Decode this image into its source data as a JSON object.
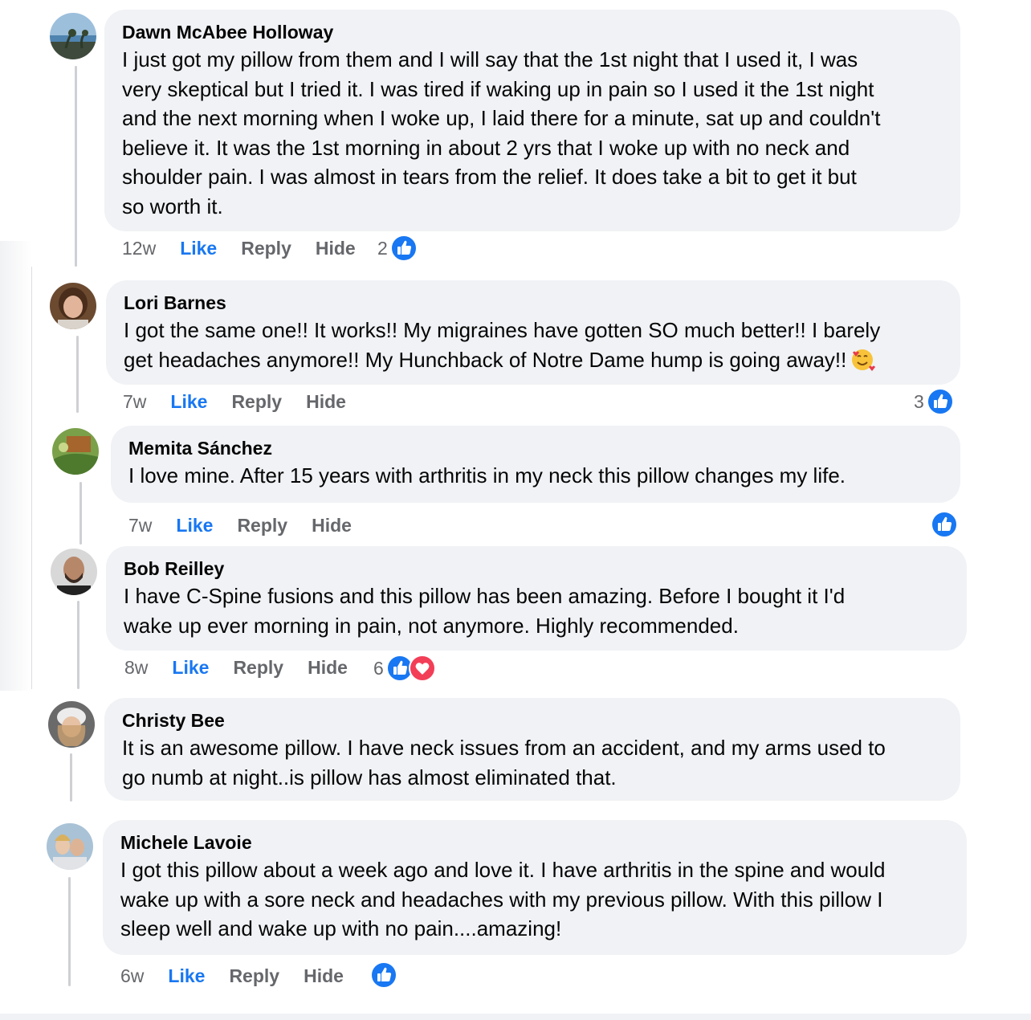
{
  "colors": {
    "bubble": "#f0f2f5",
    "like_blue": "#1877f2",
    "love_red": "#f33e58",
    "meta_gray": "#65676b",
    "thread_line": "#ced0d4"
  },
  "comments": [
    {
      "author": "Dawn McAbee Holloway",
      "text": "I just got my pillow from them and I will say that the 1st night that I used it, I was\nvery skeptical but I tried it. I was tired if waking up in pain so I used it the 1st night\nand the next morning when I woke up, I laid there for a minute, sat up and couldn't\nbelieve it. It was the 1st morning in about 2 yrs that I woke up with no neck and\nshoulder pain. I was almost in tears from the relief. It does take a bit to get it but\nso worth it.",
      "time": "12w",
      "like": "Like",
      "reply": "Reply",
      "hide": "Hide",
      "reaction_count": "2",
      "reactions": [
        "like-icon"
      ]
    },
    {
      "author": "Lori Barnes",
      "text": "I got the same one!! It works!! My migraines have gotten SO much better!! I barely\nget headaches anymore!! My Hunchback of Notre Dame hump is going away!!",
      "emoji": "smiling-face-with-hearts-emoji",
      "time": "7w",
      "like": "Like",
      "reply": "Reply",
      "hide": "Hide",
      "reaction_count": "3",
      "reactions": [
        "like-icon"
      ]
    },
    {
      "author": "Memita Sánchez",
      "text": "I love mine. After 15 years with arthritis in my neck this pillow changes my life.",
      "time": "7w",
      "like": "Like",
      "reply": "Reply",
      "hide": "Hide",
      "reaction_count": "",
      "reactions": [
        "like-icon"
      ]
    },
    {
      "author": "Bob Reilley",
      "text": "I have C-Spine fusions and this pillow has been amazing. Before I bought it I'd\nwake up ever morning in pain, not anymore. Highly recommended.",
      "time": "8w",
      "like": "Like",
      "reply": "Reply",
      "hide": "Hide",
      "reaction_count": "6",
      "reactions": [
        "like-icon",
        "love-icon"
      ]
    },
    {
      "author": "Christy Bee",
      "text": "It is an awesome pillow. I have neck issues from an accident, and my arms used to\ngo numb at night..is pillow has almost eliminated that."
    },
    {
      "author": "Michele Lavoie",
      "text": "I got this pillow about a week ago and love it. I have arthritis in the spine and would\nwake up with a sore neck and headaches with my previous pillow. With this pillow I\nsleep well and wake up with no pain....amazing!",
      "time": "6w",
      "like": "Like",
      "reply": "Reply",
      "hide": "Hide",
      "reaction_count": "",
      "reactions": [
        "like-icon"
      ]
    }
  ]
}
